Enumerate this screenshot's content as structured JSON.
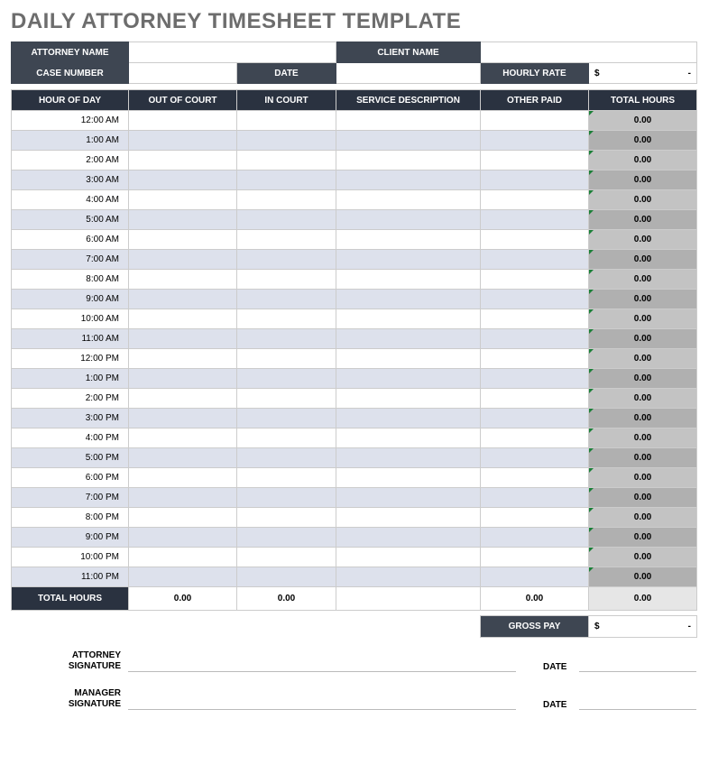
{
  "title": "DAILY ATTORNEY TIMESHEET TEMPLATE",
  "meta": {
    "attorney_name_label": "ATTORNEY NAME",
    "client_name_label": "CLIENT NAME",
    "case_number_label": "CASE NUMBER",
    "date_label": "DATE",
    "hourly_rate_label": "HOURLY RATE",
    "attorney_name_value": "",
    "client_name_value": "",
    "case_number_value": "",
    "date_value": "",
    "hourly_rate_currency": "$",
    "hourly_rate_value": "-"
  },
  "columns": {
    "hour_of_day": "HOUR OF DAY",
    "out_of_court": "OUT OF COURT",
    "in_court": "IN COURT",
    "service_description": "SERVICE DESCRIPTION",
    "other_paid": "OTHER PAID",
    "total_hours": "TOTAL HOURS"
  },
  "rows": [
    {
      "hour": "12:00 AM",
      "out": "",
      "in": "",
      "desc": "",
      "other": "",
      "total": "0.00"
    },
    {
      "hour": "1:00 AM",
      "out": "",
      "in": "",
      "desc": "",
      "other": "",
      "total": "0.00"
    },
    {
      "hour": "2:00 AM",
      "out": "",
      "in": "",
      "desc": "",
      "other": "",
      "total": "0.00"
    },
    {
      "hour": "3:00 AM",
      "out": "",
      "in": "",
      "desc": "",
      "other": "",
      "total": "0.00"
    },
    {
      "hour": "4:00 AM",
      "out": "",
      "in": "",
      "desc": "",
      "other": "",
      "total": "0.00"
    },
    {
      "hour": "5:00 AM",
      "out": "",
      "in": "",
      "desc": "",
      "other": "",
      "total": "0.00"
    },
    {
      "hour": "6:00 AM",
      "out": "",
      "in": "",
      "desc": "",
      "other": "",
      "total": "0.00"
    },
    {
      "hour": "7:00 AM",
      "out": "",
      "in": "",
      "desc": "",
      "other": "",
      "total": "0.00"
    },
    {
      "hour": "8:00 AM",
      "out": "",
      "in": "",
      "desc": "",
      "other": "",
      "total": "0.00"
    },
    {
      "hour": "9:00 AM",
      "out": "",
      "in": "",
      "desc": "",
      "other": "",
      "total": "0.00"
    },
    {
      "hour": "10:00 AM",
      "out": "",
      "in": "",
      "desc": "",
      "other": "",
      "total": "0.00"
    },
    {
      "hour": "11:00 AM",
      "out": "",
      "in": "",
      "desc": "",
      "other": "",
      "total": "0.00"
    },
    {
      "hour": "12:00 PM",
      "out": "",
      "in": "",
      "desc": "",
      "other": "",
      "total": "0.00"
    },
    {
      "hour": "1:00 PM",
      "out": "",
      "in": "",
      "desc": "",
      "other": "",
      "total": "0.00"
    },
    {
      "hour": "2:00 PM",
      "out": "",
      "in": "",
      "desc": "",
      "other": "",
      "total": "0.00"
    },
    {
      "hour": "3:00 PM",
      "out": "",
      "in": "",
      "desc": "",
      "other": "",
      "total": "0.00"
    },
    {
      "hour": "4:00 PM",
      "out": "",
      "in": "",
      "desc": "",
      "other": "",
      "total": "0.00"
    },
    {
      "hour": "5:00 PM",
      "out": "",
      "in": "",
      "desc": "",
      "other": "",
      "total": "0.00"
    },
    {
      "hour": "6:00 PM",
      "out": "",
      "in": "",
      "desc": "",
      "other": "",
      "total": "0.00"
    },
    {
      "hour": "7:00 PM",
      "out": "",
      "in": "",
      "desc": "",
      "other": "",
      "total": "0.00"
    },
    {
      "hour": "8:00 PM",
      "out": "",
      "in": "",
      "desc": "",
      "other": "",
      "total": "0.00"
    },
    {
      "hour": "9:00 PM",
      "out": "",
      "in": "",
      "desc": "",
      "other": "",
      "total": "0.00"
    },
    {
      "hour": "10:00 PM",
      "out": "",
      "in": "",
      "desc": "",
      "other": "",
      "total": "0.00"
    },
    {
      "hour": "11:00 PM",
      "out": "",
      "in": "",
      "desc": "",
      "other": "",
      "total": "0.00"
    }
  ],
  "totals": {
    "label": "TOTAL HOURS",
    "out": "0.00",
    "in": "0.00",
    "desc": "",
    "other": "0.00",
    "total": "0.00"
  },
  "gross": {
    "label": "GROSS PAY",
    "currency": "$",
    "value": "-"
  },
  "signatures": {
    "attorney_label": "ATTORNEY\nSIGNATURE",
    "manager_label": "MANAGER\nSIGNATURE",
    "date_label": "DATE"
  }
}
